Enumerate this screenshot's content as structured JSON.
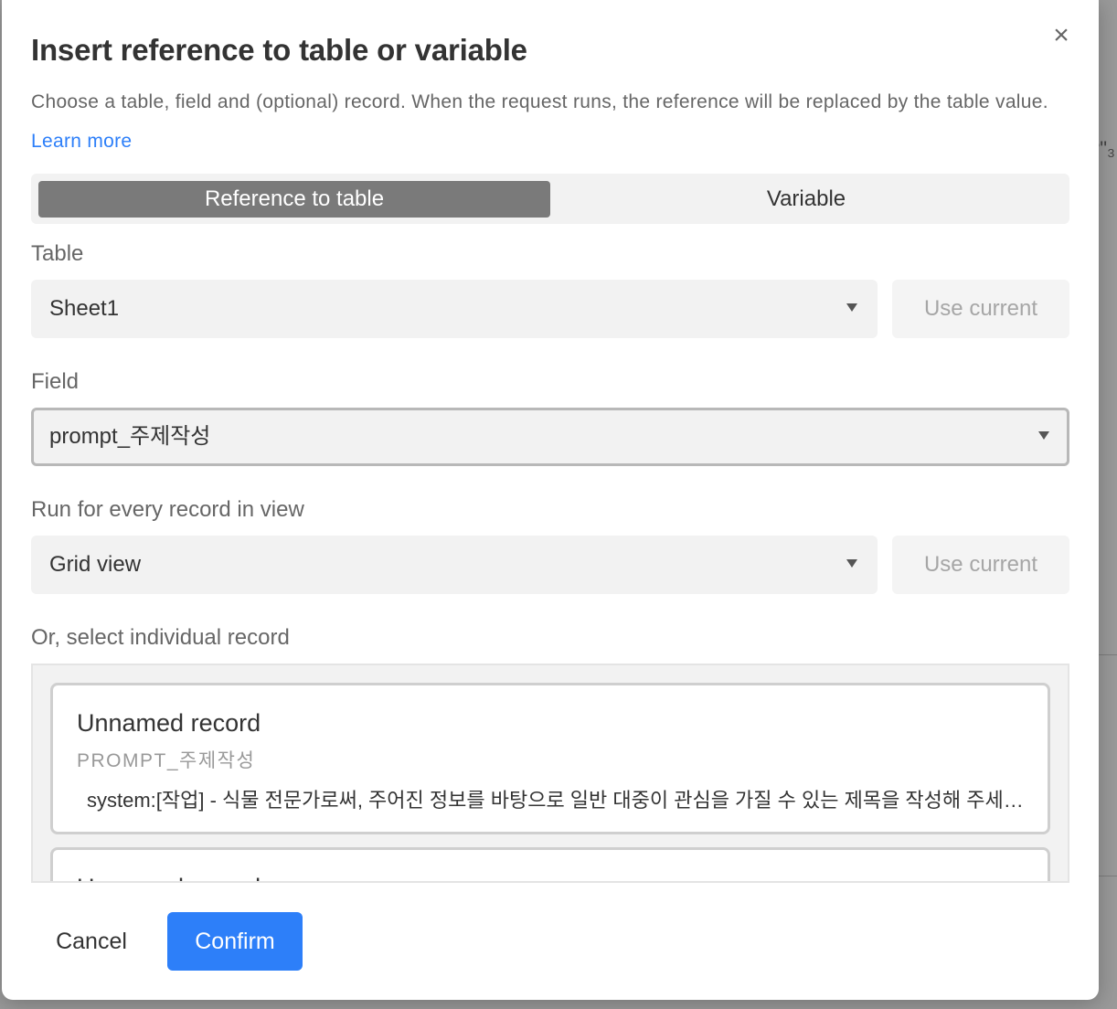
{
  "background": {
    "edge_text": "?\"₃"
  },
  "dialog": {
    "title": "Insert reference to table or variable",
    "description": "Choose a table, field and (optional) record. When the request runs, the reference will be replaced by the table value.",
    "learn_more": "Learn more",
    "close_icon": "×"
  },
  "tabs": [
    {
      "label": "Reference to table",
      "active": true
    },
    {
      "label": "Variable",
      "active": false
    }
  ],
  "table": {
    "label": "Table",
    "value": "Sheet1",
    "use_current": "Use current"
  },
  "field": {
    "label": "Field",
    "value": "prompt_주제작성"
  },
  "view": {
    "label": "Run for every record in view",
    "value": "Grid view",
    "use_current": "Use current"
  },
  "records": {
    "label": "Or, select individual record",
    "items": [
      {
        "name": "Unnamed record",
        "field": "PROMPT_주제작성",
        "value": "system:[작업] - 식물 전문가로써, 주어진 정보를 바탕으로 일반 대중이 관심을 가질 수 있는 제목을 작성해 주세요."
      },
      {
        "name": "Unnamed record",
        "field": "",
        "value": ""
      }
    ]
  },
  "footer": {
    "cancel": "Cancel",
    "confirm": "Confirm"
  },
  "colors": {
    "accent": "#2d7ff9",
    "active_tab": "#7a7a7a",
    "input_bg": "#f2f2f2"
  }
}
